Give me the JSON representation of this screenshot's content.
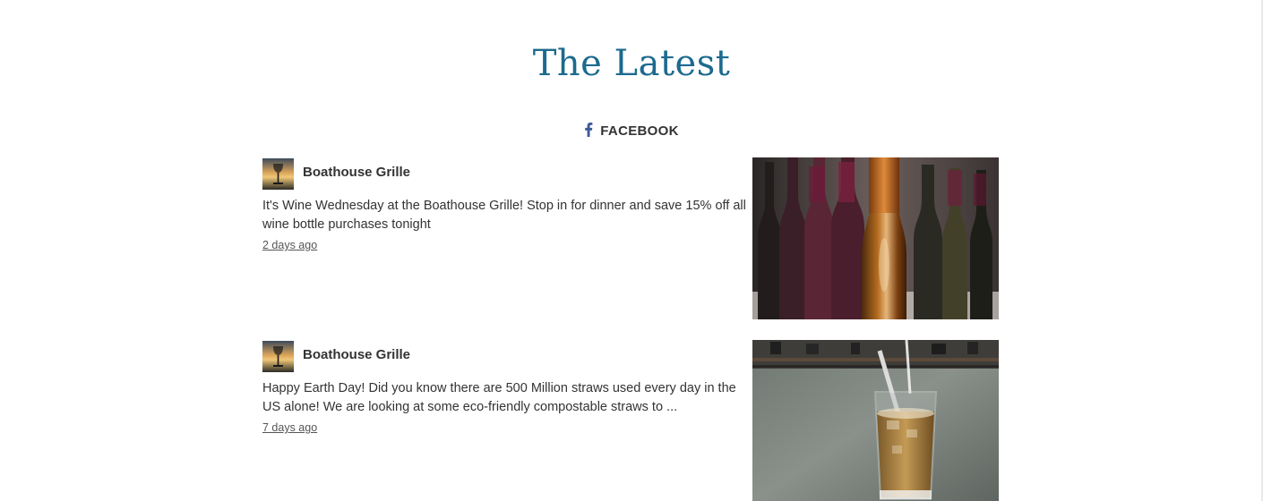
{
  "section": {
    "title": "The Latest"
  },
  "feed_tab": {
    "label": "FACEBOOK",
    "icon": "facebook-icon",
    "color": "#3b5998"
  },
  "posts": [
    {
      "author": "Boathouse Grille",
      "text": "It's Wine Wednesday at the Boathouse Grille! Stop in for dinner and save 15% off all wine bottle purchases tonight",
      "time": "2 days ago",
      "image": "wine-bottles-photo"
    },
    {
      "author": "Boathouse Grille",
      "text": "Happy Earth Day! Did you know there are 500 Million straws used every day in the US alone! We are looking at some eco-friendly compostable straws to ...",
      "time": "7 days ago",
      "image": "iced-drink-with-straw-photo"
    }
  ],
  "colors": {
    "title": "#1d6a8f",
    "text": "#333333"
  }
}
